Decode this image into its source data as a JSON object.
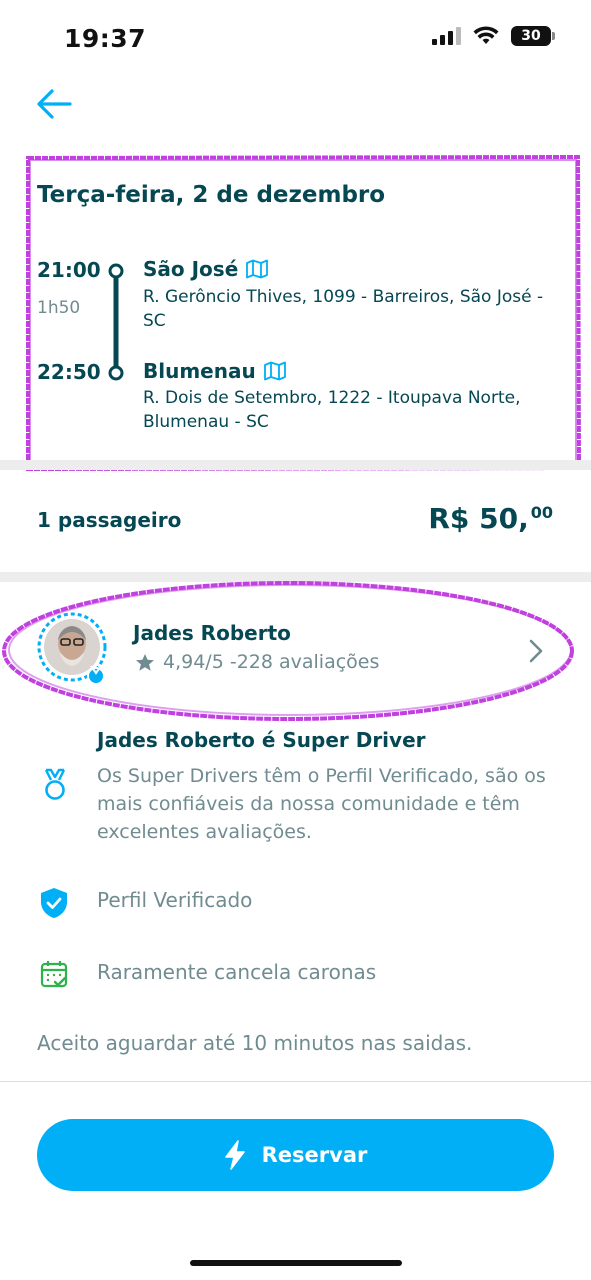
{
  "status_bar": {
    "time": "19:37",
    "battery": "30"
  },
  "trip": {
    "date": "Terça-feira, 2 de dezembro",
    "departure": {
      "time": "21:00",
      "city": "São José",
      "address": "R. Gerôncio Thives, 1099 - Barreiros, São José - SC"
    },
    "duration": "1h50",
    "arrival": {
      "time": "22:50",
      "city": "Blumenau",
      "address": "R. Dois de Setembro, 1222 - Itoupava Norte, Blumenau - SC"
    }
  },
  "booking": {
    "passengers": "1 passageiro",
    "price_main": "R$ 50,",
    "price_cents": "00"
  },
  "driver": {
    "name": "Jades Roberto",
    "rating": "4,94/5 -228 avaliações"
  },
  "super_driver": {
    "title": "Jades Roberto é Super Driver",
    "text": "Os Super Drivers têm o Perfil Verificado, são os mais confiáveis da nossa comunidade e têm excelentes avaliações."
  },
  "features": {
    "verified": "Perfil Verificado",
    "rarely_cancels": "Raramente cancela caronas"
  },
  "note": "Aceito aguardar até 10 minutos nas saidas.",
  "actions": {
    "reserve_label": "Reservar"
  },
  "colors": {
    "primary": "#00aff5",
    "text_dark": "#054752",
    "text_muted": "#708c91",
    "annotation": "#c040e0"
  }
}
